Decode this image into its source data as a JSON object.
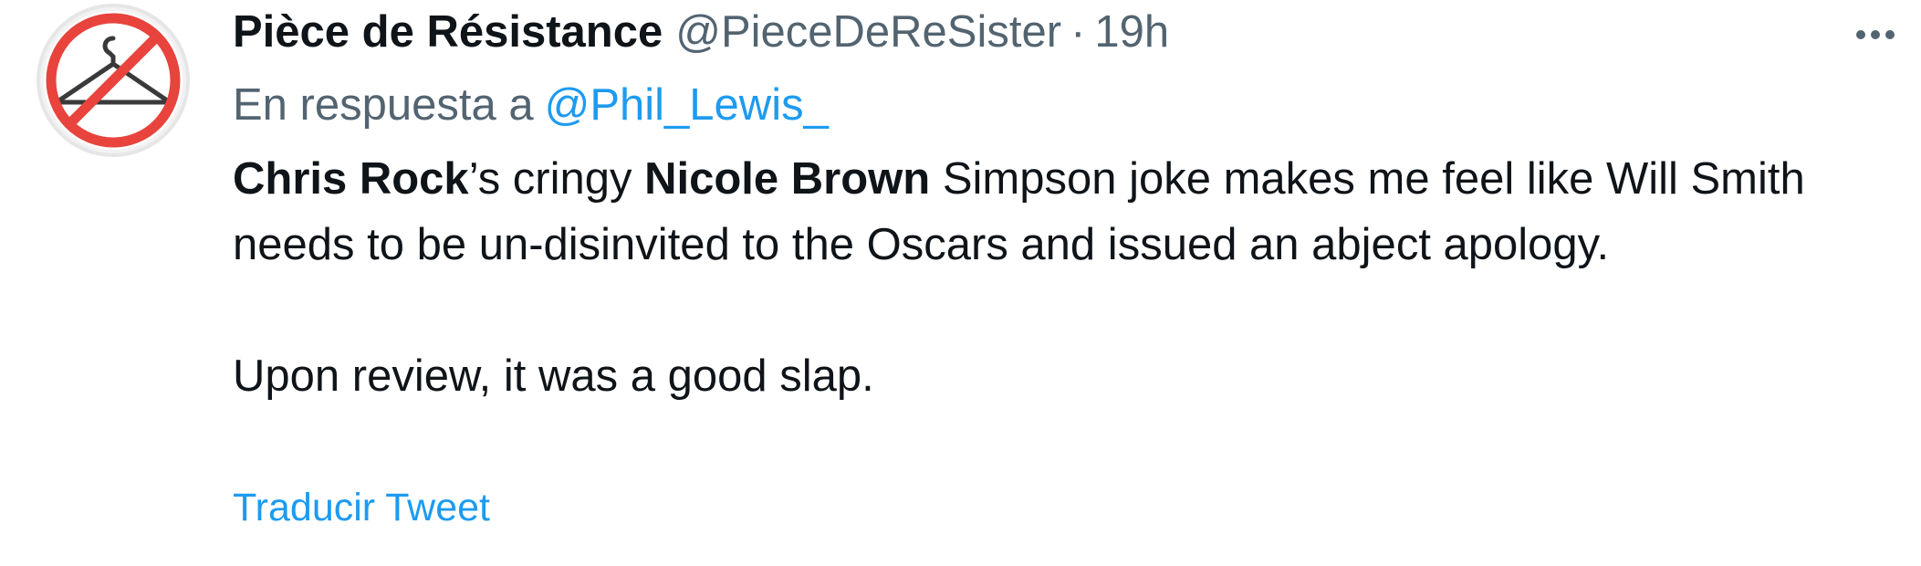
{
  "tweet": {
    "author": {
      "display_name": "Pièce de Résistance",
      "handle": "@PieceDeReSister",
      "avatar_icon": "crossed-hanger-icon"
    },
    "separator": "·",
    "time": "19h",
    "more_icon": "more-options-icon",
    "reply": {
      "prefix": "En respuesta a",
      "mention": "@Phil_Lewis_"
    },
    "body": {
      "line1_bold1": "Chris Rock",
      "line1_text1": "’s cringy ",
      "line1_bold2": "Nicole Brown",
      "line1_text2": " Simpson joke makes me feel like Will Smith needs to be un-disinvited to the Oscars and issued an abject apology.",
      "paragraph2": "Upon review, it was a good slap."
    },
    "translate_label": "Traducir Tweet"
  },
  "colors": {
    "text_primary": "#0f1419",
    "text_secondary": "#536471",
    "link": "#1d9bf0",
    "prohibition_red": "#e8433c"
  }
}
